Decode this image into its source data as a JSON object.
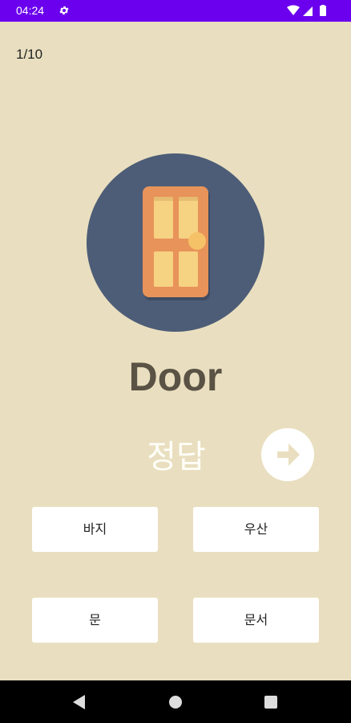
{
  "status_bar": {
    "time": "04:24",
    "icons": [
      "settings-gear-icon",
      "wifi-icon",
      "signal-icon",
      "battery-icon"
    ]
  },
  "quiz": {
    "progress": "1/10",
    "image_icon": "door-icon",
    "word": "Door",
    "answer_label": "정답",
    "next_icon": "arrow-right-icon",
    "options": [
      "바지",
      "우산",
      "문",
      "문서"
    ]
  },
  "nav_bar": {
    "icons": [
      "back-triangle-icon",
      "home-circle-icon",
      "recents-square-icon"
    ]
  },
  "colors": {
    "status_bar": "#6a00ee",
    "background": "#e9dfc0",
    "circle": "#4d5d77",
    "door": "#e8935a",
    "door_panel": "#f6d283",
    "word": "#5a5244",
    "answer_label": "#fffef8",
    "nav_bar": "#000000"
  }
}
